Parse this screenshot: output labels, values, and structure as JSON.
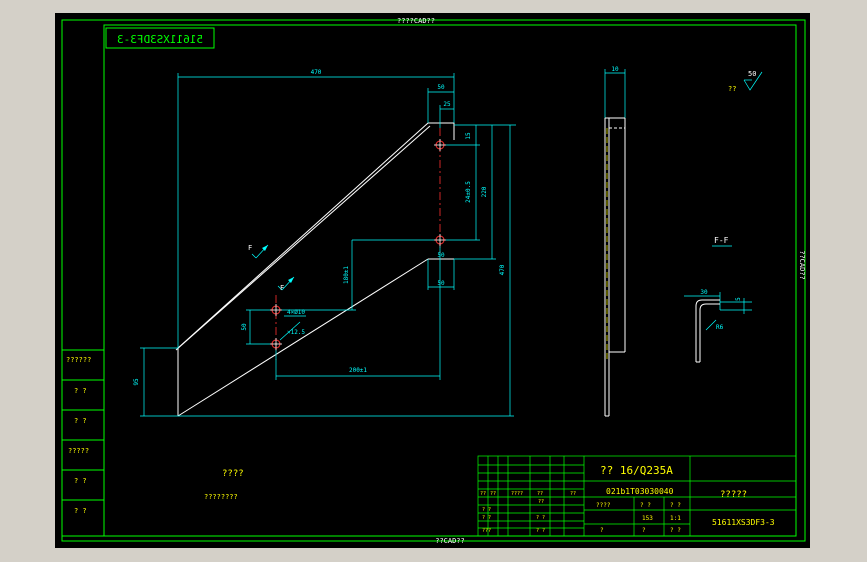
{
  "colors": {
    "border": "#00ff00",
    "part": "#ffffff",
    "dim": "#00ffff",
    "center": "#ff3030",
    "text": "#ffff00",
    "bg": "#000000"
  },
  "title_top": "????CAD??",
  "title_bottom": "??CAD??",
  "title_right": "??CAD??",
  "mirror_code": "51611XS3DF3-3",
  "dims": {
    "d470": "470",
    "d50a": "50",
    "d25": "25",
    "d15": "15",
    "d24": "24±0.5",
    "d220": "220",
    "d470v": "470",
    "d180": "180±1",
    "d50b": "50",
    "d50c": "50",
    "d4x10": "4×Ø10",
    "d12": "×12.5",
    "d200": "200±1",
    "d95": "95",
    "d10": "10",
    "d30": "30",
    "d5": "5",
    "r6": "R6"
  },
  "labels": {
    "f1": "F",
    "f2": "F",
    "section": "F-F",
    "roughness_val": "50",
    "roughness_q": "??"
  },
  "left_col": [
    "??????",
    "? ?",
    "? ?",
    "?????",
    "? ?",
    "? ?"
  ],
  "notes": {
    "line1": "????",
    "line2": "????????"
  },
  "title_block": {
    "material": "?? 16/Q235A",
    "drawing_no": "021b1T03030040",
    "name": "?????",
    "part_code": "51611XS3DF3-3",
    "row1": [
      "??",
      "??",
      "????",
      "??",
      "??"
    ],
    "row2a": [
      "? ?",
      "??"
    ],
    "row2b": [
      "? ?",
      "? ?"
    ],
    "row2c": [
      "???",
      "? ?"
    ],
    "row_scale": [
      "????",
      "? ?",
      "? ?"
    ],
    "weight": "153",
    "scale": "1:1",
    "sheet": [
      "?",
      "?",
      "? ?"
    ]
  }
}
